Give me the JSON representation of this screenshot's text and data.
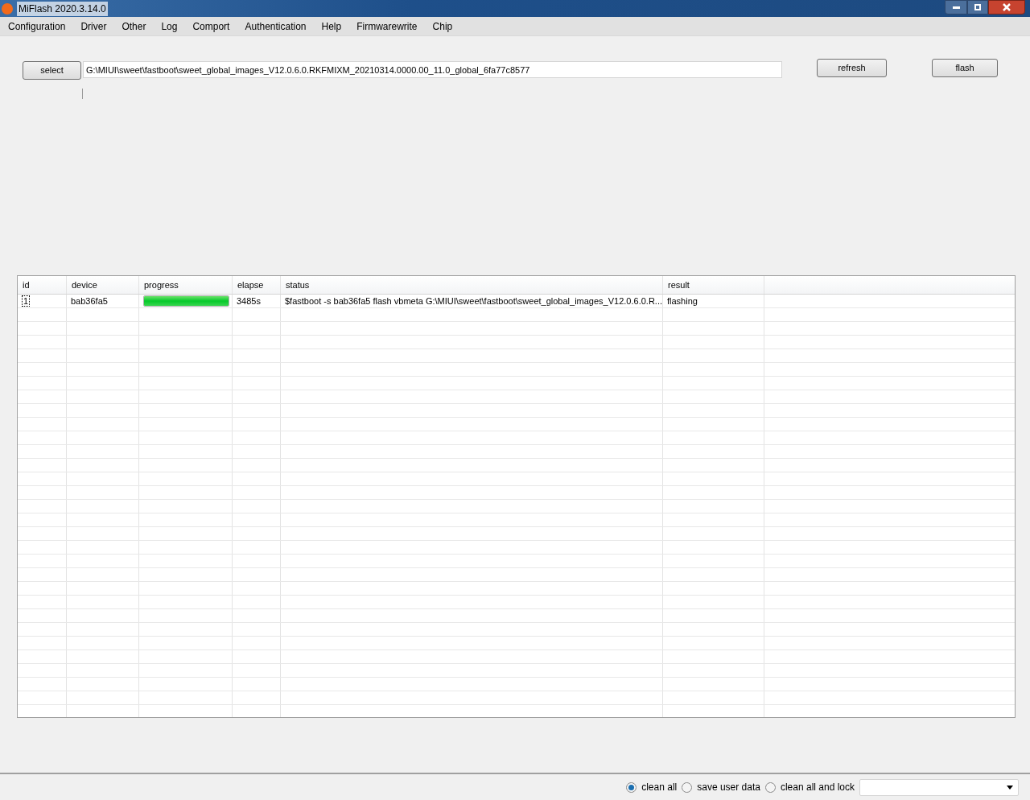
{
  "window": {
    "title": "MiFlash 2020.3.14.0"
  },
  "menu": [
    "Configuration",
    "Driver",
    "Other",
    "Log",
    "Comport",
    "Authentication",
    "Help",
    "Firmwarewrite",
    "Chip"
  ],
  "select_button": "select",
  "path_field": {
    "value": "G:\\MIUI\\sweet\\fastboot\\sweet_global_images_V12.0.6.0.RKFMIXM_20210314.0000.00_11.0_global_6fa77c8577"
  },
  "refresh_button": "refresh",
  "flash_button": "flash",
  "table": {
    "columns": [
      "id",
      "device",
      "progress",
      "elapse",
      "status",
      "result"
    ],
    "rows": [
      {
        "id": "1",
        "device": "bab36fa5",
        "level": 1,
        "elapse": "3485s",
        "status": "$fastboot -s bab36fa5 flash vbmeta G:\\MIUI\\sweet\\fastboot\\sweet_global_images_V12.0.6.0.R...",
        "result": "flashing"
      }
    ]
  },
  "options": [
    {
      "label": "clean all",
      "selected": true
    },
    {
      "label": "save user data",
      "selected": false
    },
    {
      "label": "clean all and lock",
      "selected": false
    }
  ]
}
